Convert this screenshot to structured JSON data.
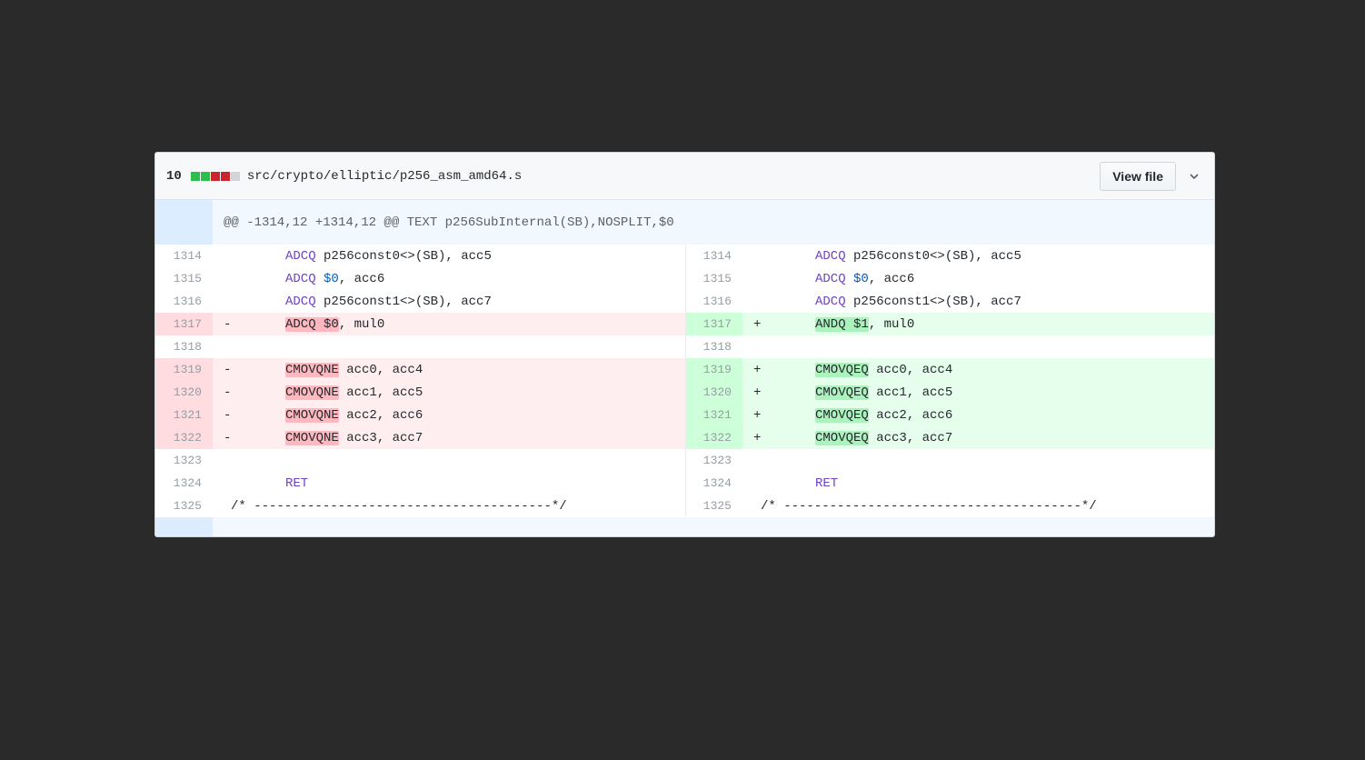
{
  "file": {
    "change_count": "10",
    "diffstat_colors": [
      "#2cbe4e",
      "#2cbe4e",
      "#cb2431",
      "#cb2431",
      "#d1d5da"
    ],
    "path": "src/crypto/elliptic/p256_asm_amd64.s",
    "view_file_label": "View file",
    "icons": {
      "expand_up": "expand-up-icon",
      "expand_down": "expand-down-icon",
      "collapse": "chevron-down-icon"
    }
  },
  "hunk_header": "@@ -1314,12 +1314,12 @@ TEXT p256SubInternal(SB),NOSPLIT,$0",
  "colors": {
    "deleted_line": "#ffeef0",
    "added_line": "#e6ffed",
    "deleted_highlight": "#fdb8c0",
    "added_highlight": "#acf2bd",
    "keyword": "#6f42c1",
    "constant": "#005cc5"
  },
  "rows": [
    {
      "type": "context",
      "left_num": "1314",
      "right_num": "1314",
      "left": [
        {
          "t": "ADCQ",
          "c": "kw"
        },
        {
          "t": " p256const0<>(SB), acc5"
        }
      ],
      "right": [
        {
          "t": "ADCQ",
          "c": "kw"
        },
        {
          "t": " p256const0<>(SB), acc5"
        }
      ]
    },
    {
      "type": "context",
      "left_num": "1315",
      "right_num": "1315",
      "left": [
        {
          "t": "ADCQ",
          "c": "kw"
        },
        {
          "t": " "
        },
        {
          "t": "$0",
          "c": "cst"
        },
        {
          "t": ", acc6"
        }
      ],
      "right": [
        {
          "t": "ADCQ",
          "c": "kw"
        },
        {
          "t": " "
        },
        {
          "t": "$0",
          "c": "cst"
        },
        {
          "t": ", acc6"
        }
      ]
    },
    {
      "type": "context",
      "left_num": "1316",
      "right_num": "1316",
      "left": [
        {
          "t": "ADCQ",
          "c": "kw"
        },
        {
          "t": " p256const1<>(SB), acc7"
        }
      ],
      "right": [
        {
          "t": "ADCQ",
          "c": "kw"
        },
        {
          "t": " p256const1<>(SB), acc7"
        }
      ]
    },
    {
      "type": "change",
      "left_num": "1317",
      "right_num": "1317",
      "left_marker": "-",
      "right_marker": "+",
      "left": [
        {
          "t": "ADCQ $0",
          "c": "hl-del"
        },
        {
          "t": ", mul0"
        }
      ],
      "right": [
        {
          "t": "ANDQ $1",
          "c": "hl-add"
        },
        {
          "t": ", mul0"
        }
      ]
    },
    {
      "type": "context",
      "left_num": "1318",
      "right_num": "1318",
      "left": [],
      "right": []
    },
    {
      "type": "change",
      "left_num": "1319",
      "right_num": "1319",
      "left_marker": "-",
      "right_marker": "+",
      "left": [
        {
          "t": "CMOVQNE",
          "c": "hl-del"
        },
        {
          "t": " acc0, acc4"
        }
      ],
      "right": [
        {
          "t": "CMOVQEQ",
          "c": "hl-add"
        },
        {
          "t": " acc0, acc4"
        }
      ]
    },
    {
      "type": "change",
      "left_num": "1320",
      "right_num": "1320",
      "left_marker": "-",
      "right_marker": "+",
      "left": [
        {
          "t": "CMOVQNE",
          "c": "hl-del"
        },
        {
          "t": " acc1, acc5"
        }
      ],
      "right": [
        {
          "t": "CMOVQEQ",
          "c": "hl-add"
        },
        {
          "t": " acc1, acc5"
        }
      ]
    },
    {
      "type": "change",
      "left_num": "1321",
      "right_num": "1321",
      "left_marker": "-",
      "right_marker": "+",
      "left": [
        {
          "t": "CMOVQNE",
          "c": "hl-del"
        },
        {
          "t": " acc2, acc6"
        }
      ],
      "right": [
        {
          "t": "CMOVQEQ",
          "c": "hl-add"
        },
        {
          "t": " acc2, acc6"
        }
      ]
    },
    {
      "type": "change",
      "left_num": "1322",
      "right_num": "1322",
      "left_marker": "-",
      "right_marker": "+",
      "left": [
        {
          "t": "CMOVQNE",
          "c": "hl-del"
        },
        {
          "t": " acc3, acc7"
        }
      ],
      "right": [
        {
          "t": "CMOVQEQ",
          "c": "hl-add"
        },
        {
          "t": " acc3, acc7"
        }
      ]
    },
    {
      "type": "context",
      "left_num": "1323",
      "right_num": "1323",
      "left": [],
      "right": []
    },
    {
      "type": "context",
      "left_num": "1324",
      "right_num": "1324",
      "left": [
        {
          "t": "RET",
          "c": "kw"
        }
      ],
      "right": [
        {
          "t": "RET",
          "c": "kw"
        }
      ]
    },
    {
      "type": "comment",
      "left_num": "1325",
      "right_num": "1325",
      "left": [
        {
          "t": "/* ---------------------------------------*/"
        }
      ],
      "right": [
        {
          "t": "/* ---------------------------------------*/"
        }
      ]
    }
  ]
}
